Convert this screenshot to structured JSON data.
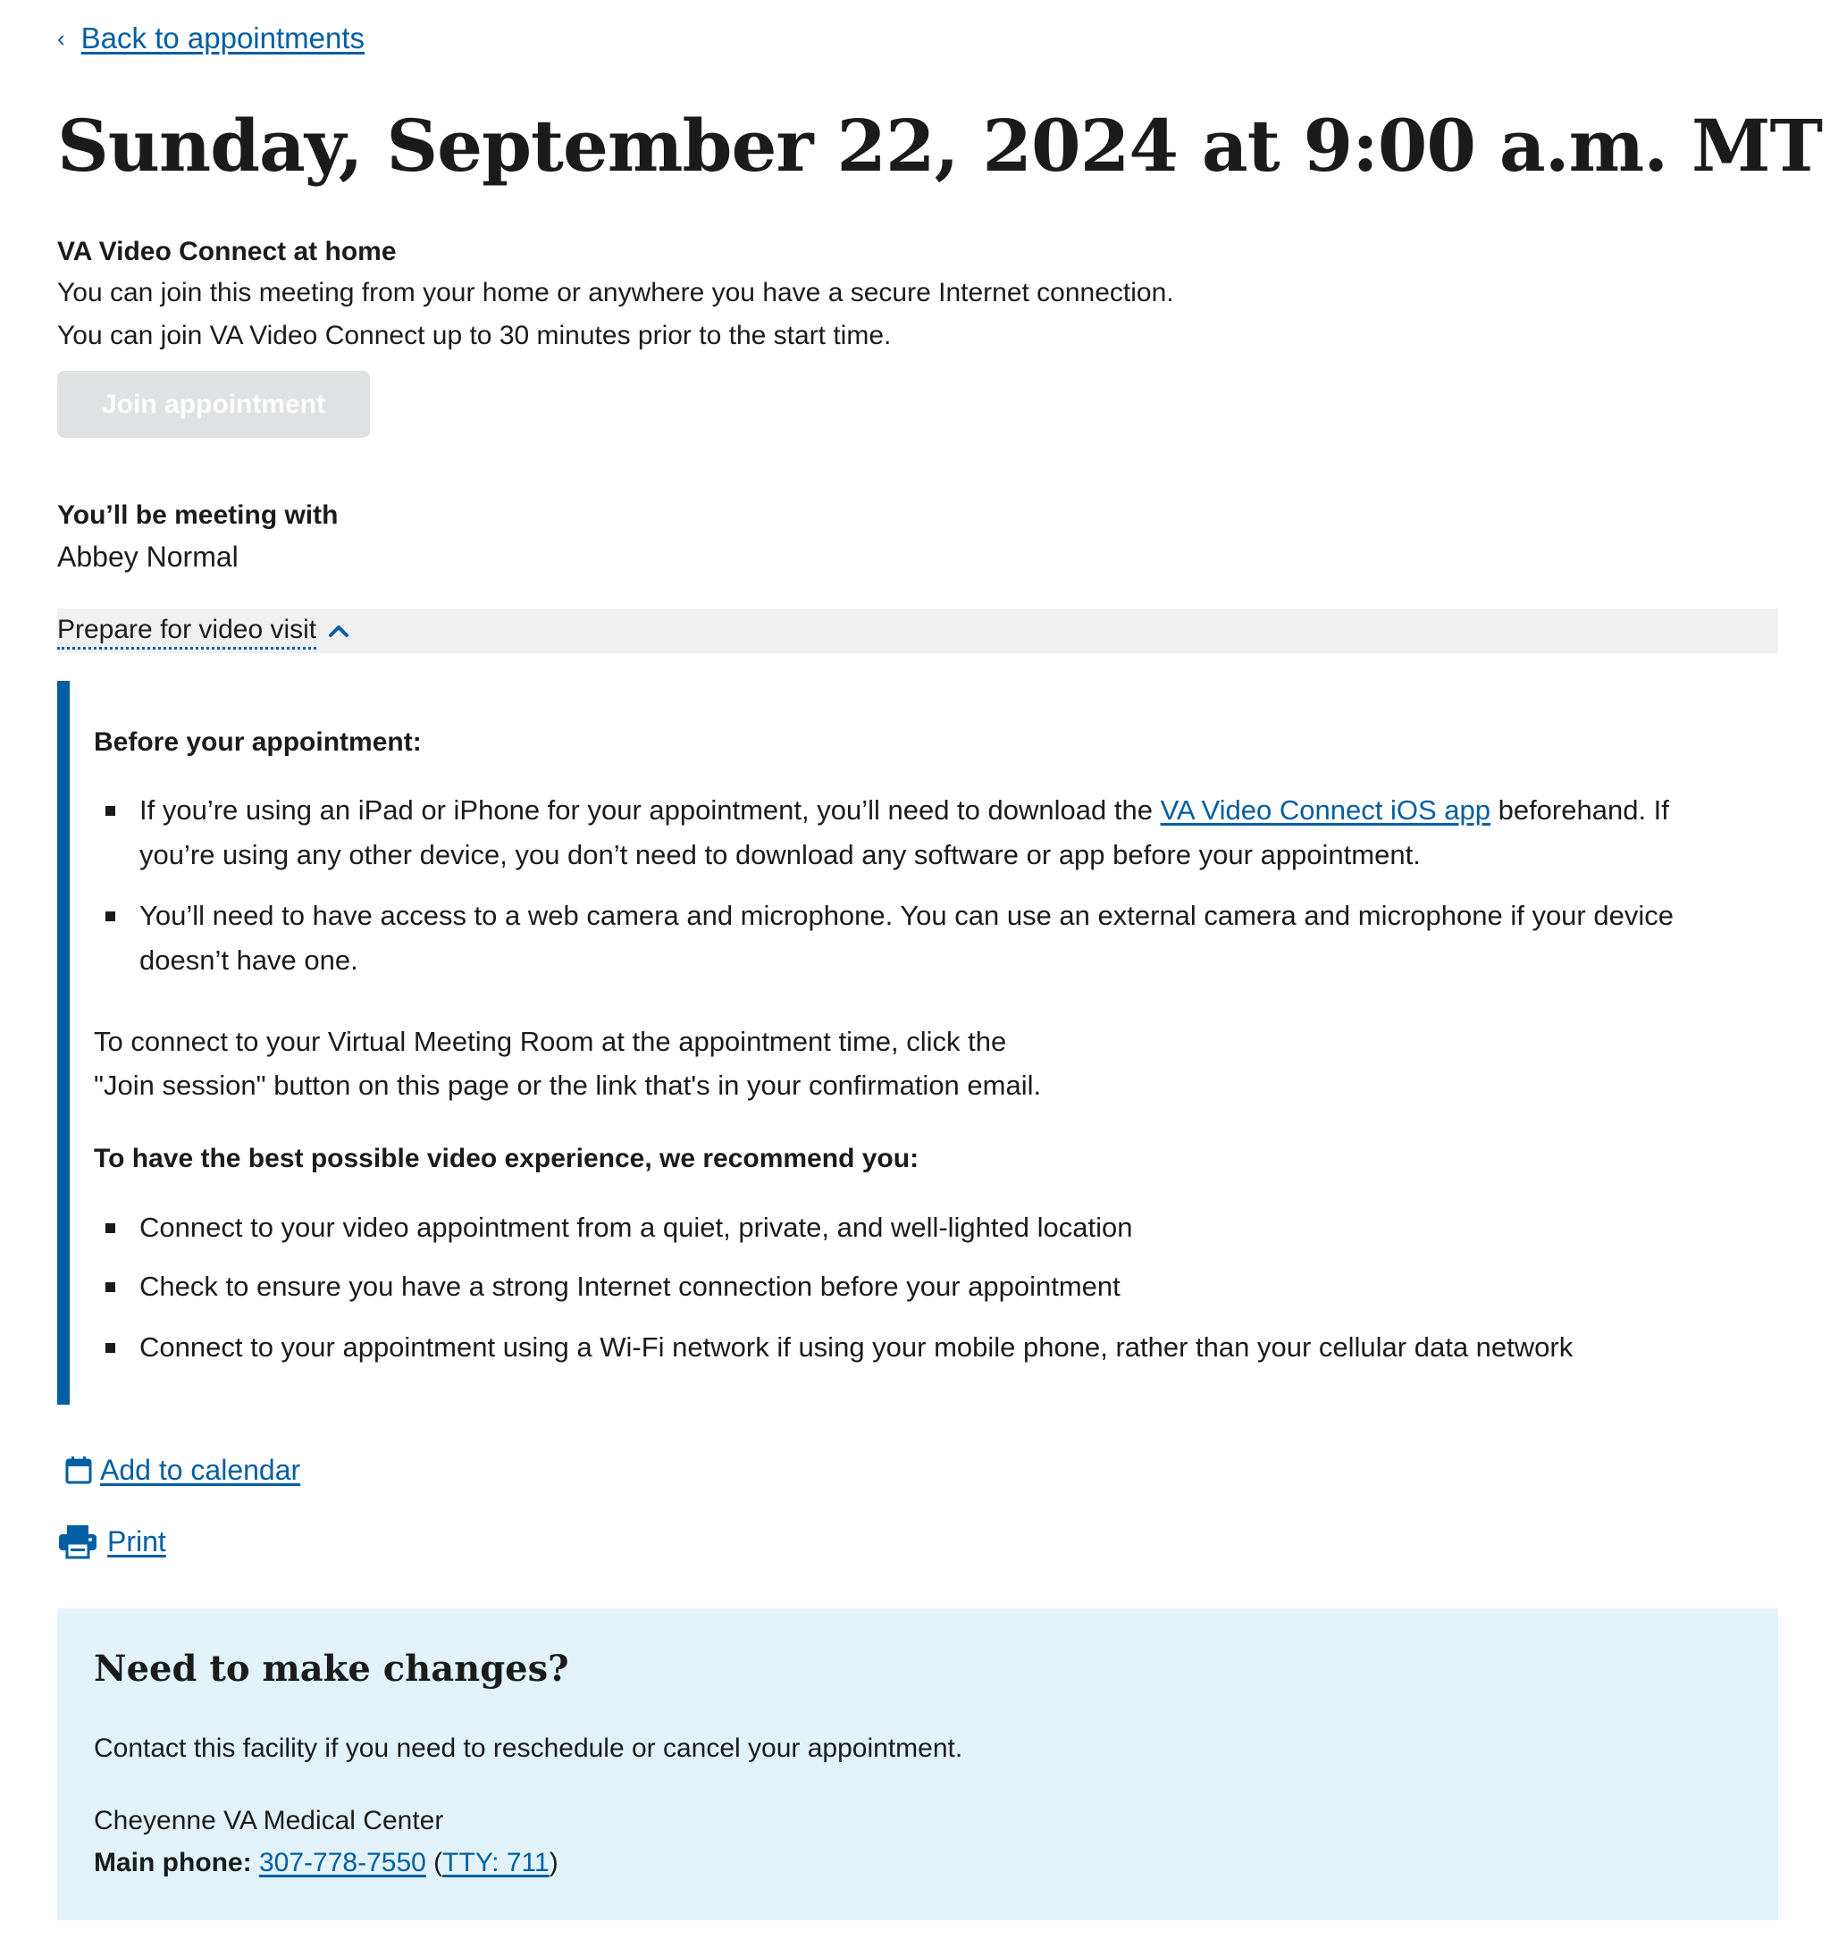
{
  "back_link": {
    "label": "Back to appointments"
  },
  "appointment": {
    "title": "Sunday, September 22, 2024 at 9:00 a.m. MT"
  },
  "video_connect": {
    "heading": "VA Video Connect at home",
    "line1": "You can join this meeting from your home or anywhere you have a secure Internet connection.",
    "line2": "You can join VA Video Connect up to 30 minutes prior to the start time.",
    "join_button": "Join appointment"
  },
  "meeting_with": {
    "heading": "You’ll be meeting with",
    "name": "Abbey Normal"
  },
  "prepare": {
    "toggle_label": "Prepare for video visit",
    "before_heading": "Before your appointment:",
    "bullet1_pre": "If you’re using an iPad or iPhone for your appointment, you’ll need to download the ",
    "bullet1_link": "VA Video Connect iOS app",
    "bullet1_post": " beforehand. If you’re using any other device, you don’t need to download any software or app before your appointment.",
    "bullet2": "You’ll need to have access to a web camera and microphone. You can use an external camera and microphone if your device doesn’t have one.",
    "connect_line1": "To connect to your Virtual Meeting Room at the appointment time, click the",
    "connect_line2": "\"Join session\" button on this page or the link that's in your confirmation email.",
    "recommend_heading": "To have the best possible video experience, we recommend you:",
    "recommendations": [
      "Connect to your video appointment from a quiet, private, and well-lighted location",
      "Check to ensure you have a strong Internet connection before your appointment",
      "Connect to your appointment using a Wi-Fi network if using your mobile phone, rather than your cellular data network"
    ]
  },
  "actions": {
    "calendar_label": "Add to calendar",
    "print_label": "Print"
  },
  "changes": {
    "heading": "Need to make changes?",
    "description": "Contact this facility if you need to reschedule or cancel your appointment.",
    "facility": "Cheyenne VA Medical Center",
    "phone_label": "Main phone:",
    "phone_number": "307-778-7550",
    "tty_label": "TTY: 711"
  },
  "colors": {
    "link": "#005ea2",
    "accent_bar": "#005ea2",
    "info_box": "#e1f3f8",
    "disabled_button": "#dfe1e2"
  }
}
